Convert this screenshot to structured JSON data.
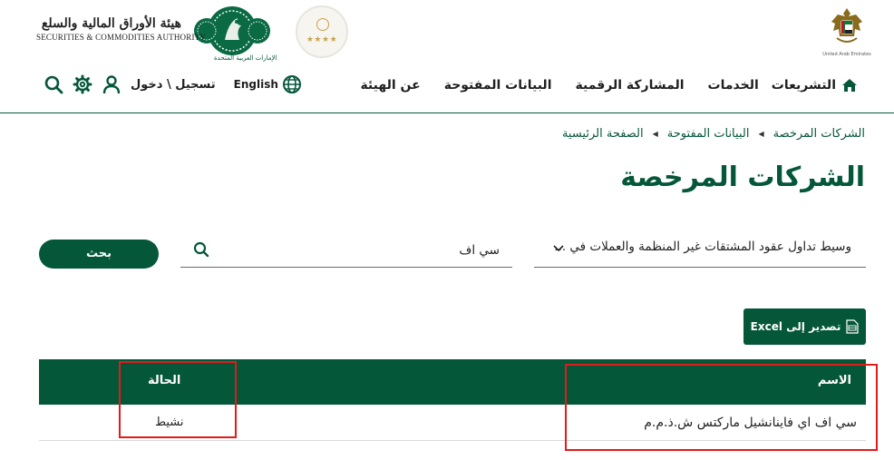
{
  "header": {
    "uae_emblem_caption": "United Arab Emirates",
    "authority_name_ar": "هيئة الأوراق المالية والسلع",
    "authority_name_en": "SECURITIES & COMMODITIES AUTHORITY",
    "logo_caption_ar": "الإمارات العربية المتحدة",
    "stars_badge": "★★★★"
  },
  "nav": {
    "items": [
      "التشريعات",
      "الخدمات",
      "المشاركة الرقمية",
      "البيانات المفتوحة",
      "عن الهيئة"
    ],
    "login_label": "تسجيل \\ دخول",
    "language_label": "English"
  },
  "breadcrumb": [
    "الصفحة الرئيسية",
    "البيانات المفتوحة",
    "الشركات المرخصة"
  ],
  "page_title": "الشركات المرخصة",
  "filters": {
    "activity_value": "وسيط تداول عقود المشتقات غير المنظمة والعملات في ...",
    "search_value": "سي اف",
    "search_button": "بحث"
  },
  "export_button": "تصدير إلى Excel",
  "table": {
    "headers": {
      "name": "الاسم",
      "status": "الحالة"
    },
    "rows": [
      {
        "name": "سي اف اي فاينانشيل ماركتس ش.ذ.م.م",
        "status": "نشيط"
      }
    ]
  },
  "colors": {
    "brand_green": "#05573a",
    "highlight_red": "#e41a1a"
  }
}
